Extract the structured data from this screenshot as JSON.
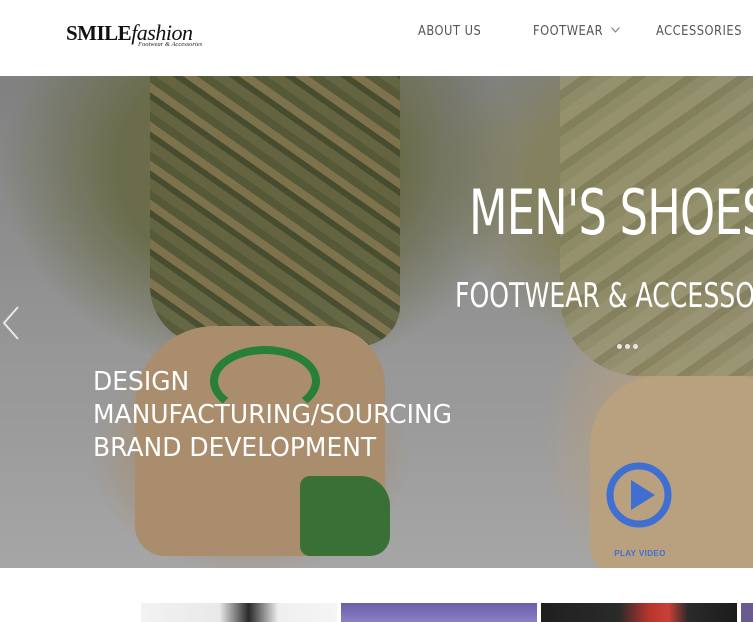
{
  "header": {
    "logo": {
      "main_bold": "SMILE",
      "main_script": "fashion",
      "sub": "Footwear & Accessories"
    },
    "nav": [
      {
        "label": "ABOUT US"
      },
      {
        "label": "FOOTWEAR",
        "has_dropdown": true
      },
      {
        "label": "ACCESSORIES"
      }
    ]
  },
  "hero": {
    "title": "MEN'S SHOES",
    "subtitle": "FOOTWEAR & ACCESSORIES",
    "tagline": [
      "DESIGN",
      "MANUFACTURING/SOURCING",
      "BRAND DEVELOPMENT"
    ],
    "play_label": "PLAY VIDEO",
    "dot_count": 3,
    "colors": {
      "text": "#ffffff",
      "play_accent": "#3f6fd1"
    }
  },
  "thumbnails": [
    {
      "name": "thumbnail-1"
    },
    {
      "name": "thumbnail-2"
    },
    {
      "name": "thumbnail-3"
    },
    {
      "name": "thumbnail-4"
    }
  ]
}
